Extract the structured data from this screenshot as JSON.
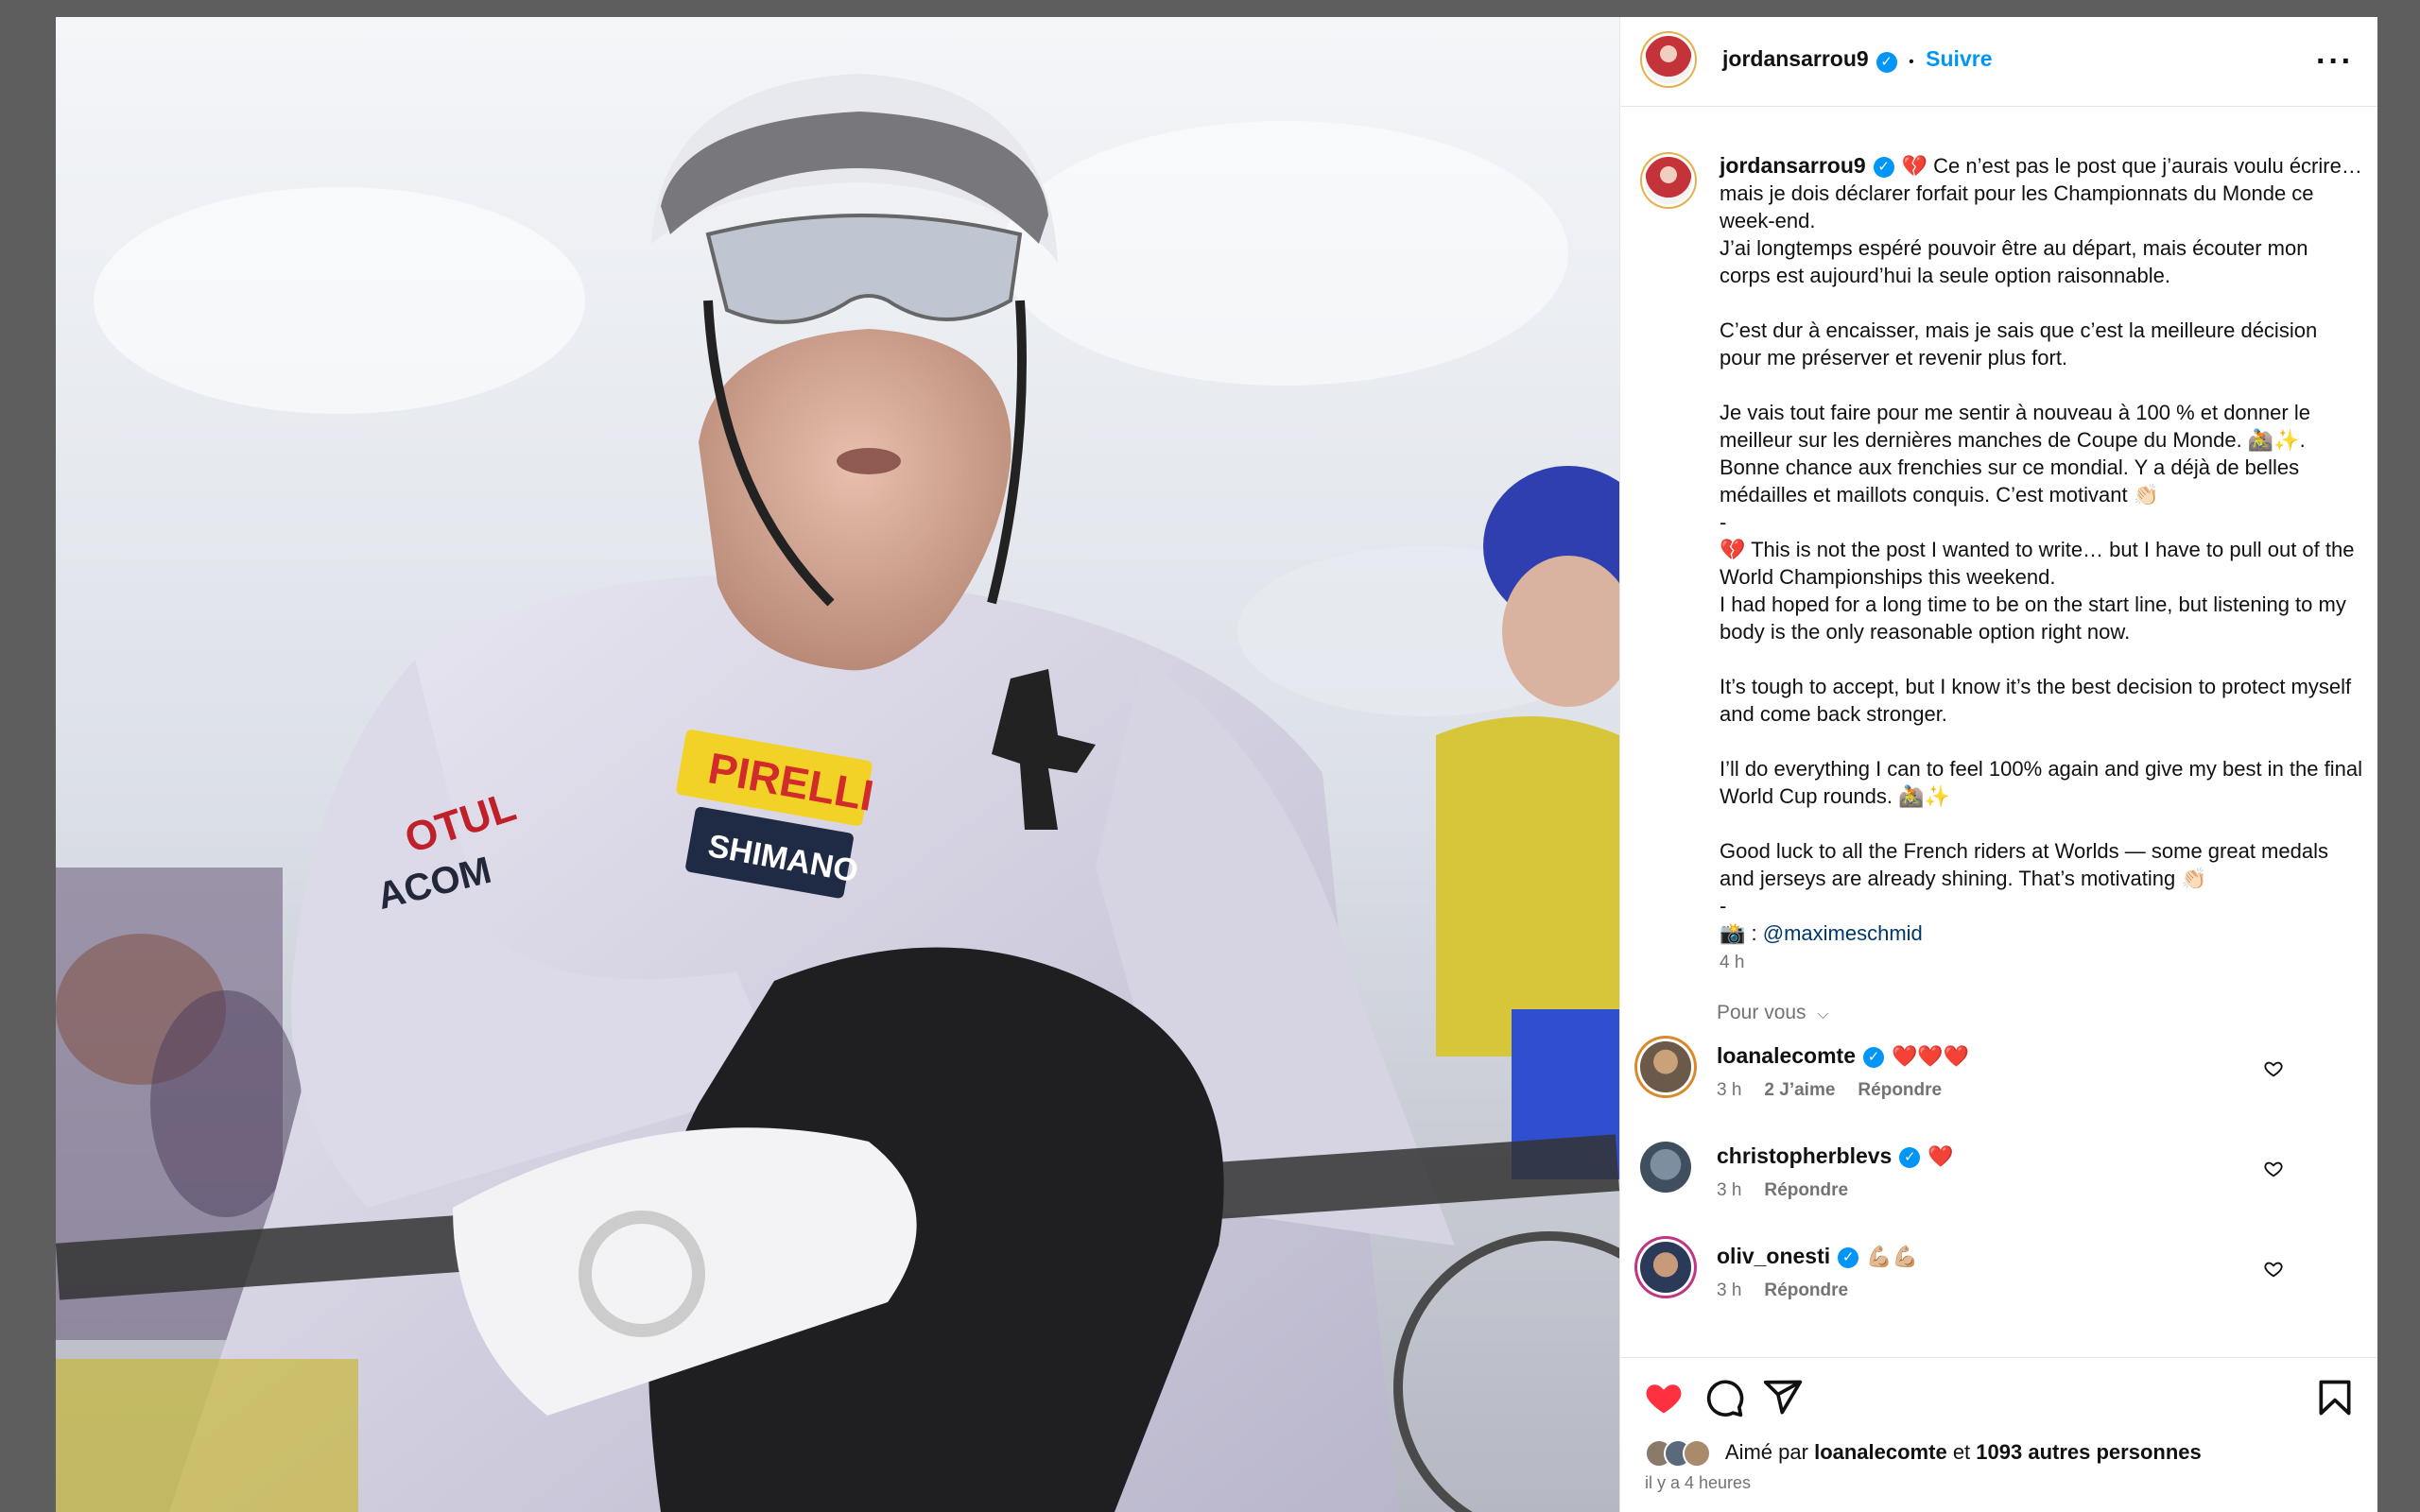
{
  "post": {
    "username": "jordansarrou9",
    "follow_label": "Suivre",
    "separator": "•",
    "more_icon": "more-horizontal-icon"
  },
  "caption": {
    "username": "jordansarrou9",
    "text": "💔 Ce n’est pas le post que j’aurais voulu écrire… mais je dois déclarer forfait pour les Championnats du Monde ce week-end.\nJ’ai longtemps espéré pouvoir être au départ, mais écouter mon corps est aujourd’hui la seule option raisonnable.\n\nC’est dur à encaisser, mais je sais que c’est la meilleure décision pour me préserver et revenir plus fort.\n\nJe vais tout faire pour me sentir à nouveau à 100 % et donner le meilleur sur les dernières manches de Coupe du Monde. 🚵✨.\nBonne chance aux frenchies sur ce mondial. Y a déjà de belles médailles et maillots conquis. C’est motivant 👏🏻\n-\n💔 This is not the post I wanted to write… but I have to pull out of the World Championships this weekend.\nI had hoped for a long time to be on the start line, but listening to my body is the only reasonable option right now.\n\nIt’s tough to accept, but I know it’s the best decision to protect myself and come back stronger.\n\nI’ll do everything I can to feel 100% again and give my best in the final World Cup rounds. 🚵✨\n\nGood luck to all the French riders at Worlds — some great medals and jerseys are already shining. That’s motivating 👏🏻\n-\n📸 : ",
    "mention": "@maximeschmid",
    "time": "4 h"
  },
  "filter_label": "Pour vous",
  "comments": [
    {
      "username": "loanalecomte",
      "text": "❤️❤️❤️",
      "time": "3 h",
      "likes": "2 J’aime",
      "reply": "Répondre"
    },
    {
      "username": "christopherblevs",
      "text": "❤️",
      "time": "3 h",
      "reply": "Répondre"
    },
    {
      "username": "oliv_onesti",
      "text": "💪🏼💪🏼",
      "time": "3 h",
      "reply": "Répondre"
    }
  ],
  "footer": {
    "liked_prefix": "Aimé par",
    "liked_user": "loanalecomte",
    "liked_and": "et",
    "liked_others": "1093 autres personnes",
    "posted_ago": "il y a 4 heures"
  },
  "icons": {
    "like": "heart-icon",
    "comment": "comment-icon",
    "share": "send-icon",
    "save": "bookmark-icon"
  },
  "colors": {
    "accent": "#0095f6",
    "like_red": "#ff3040",
    "muted": "#737373"
  }
}
